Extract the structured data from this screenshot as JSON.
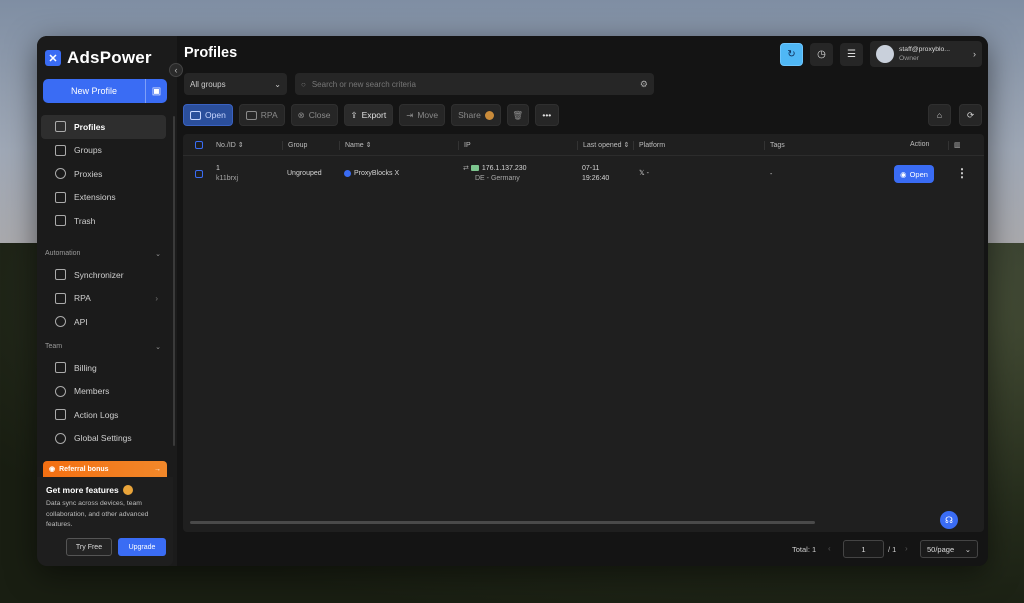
{
  "app": {
    "name": "AdsPower"
  },
  "sidebar": {
    "new_profile_label": "New Profile",
    "nav_main": [
      {
        "label": "Profiles",
        "icon": "profiles-icon",
        "active": true
      },
      {
        "label": "Groups",
        "icon": "groups-icon"
      },
      {
        "label": "Proxies",
        "icon": "proxies-icon"
      },
      {
        "label": "Extensions",
        "icon": "extensions-icon"
      },
      {
        "label": "Trash",
        "icon": "trash-icon"
      }
    ],
    "automation_label": "Automation",
    "nav_automation": [
      {
        "label": "Synchronizer",
        "icon": "synchronizer-icon"
      },
      {
        "label": "RPA",
        "icon": "rpa-icon"
      },
      {
        "label": "API",
        "icon": "api-icon"
      }
    ],
    "team_label": "Team",
    "nav_team": [
      {
        "label": "Billing",
        "icon": "billing-icon"
      },
      {
        "label": "Members",
        "icon": "members-icon"
      },
      {
        "label": "Action Logs",
        "icon": "action-logs-icon"
      },
      {
        "label": "Global Settings",
        "icon": "global-settings-icon"
      }
    ],
    "referral_label": "Referral bonus",
    "referral_arrow": "→",
    "upgrade_card": {
      "title": "Get more features",
      "description": "Data sync across devices, team collaboration, and other advanced features.",
      "try_free_label": "Try Free",
      "upgrade_label": "Upgrade"
    }
  },
  "header": {
    "title": "Profiles",
    "user_email": "staff@proxyblo...",
    "user_role": "Owner"
  },
  "filters": {
    "group_select_value": "All groups",
    "search_placeholder": "Search or new search criteria"
  },
  "toolbar": {
    "open_label": "Open",
    "rpa_label": "RPA",
    "close_label": "Close",
    "export_label": "Export",
    "move_label": "Move",
    "share_label": "Share"
  },
  "table": {
    "headers": {
      "no_id": "No./ID",
      "group": "Group",
      "name": "Name",
      "ip": "IP",
      "last_opened": "Last opened",
      "platform": "Platform",
      "tags": "Tags",
      "action": "Action"
    },
    "rows": [
      {
        "no": "1",
        "id": "k11brxj",
        "group": "Ungrouped",
        "name": "ProxyBlocks X",
        "ip": "176.1.137.230",
        "location": "DE - Germany",
        "last_opened_date": "07-11",
        "last_opened_time": "19:26:40",
        "platform": "𝕏 -",
        "tags": "-",
        "action_label": "Open"
      }
    ]
  },
  "pagination": {
    "total": "Total: 1",
    "page": "1",
    "of_pages": "/ 1",
    "per_page": "50/page"
  },
  "colors": {
    "accent": "#3a6cf4",
    "referral": "#f36f12",
    "background": "#141414"
  }
}
